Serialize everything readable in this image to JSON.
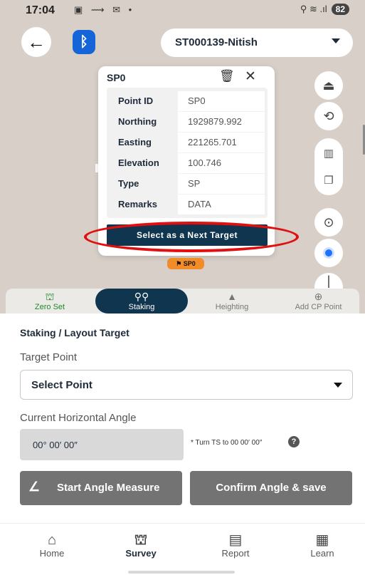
{
  "status_bar": {
    "time": "17:04",
    "left_icons": "▣ ⟿ ✉ •",
    "right_icons": "⚲ ≋ .ıl",
    "battery": "82"
  },
  "header": {
    "back_icon": "arrow-left-icon",
    "bluetooth_icon": "bluetooth-icon",
    "device_name": "ST000139-Nitish"
  },
  "popup": {
    "title": "SP0",
    "rows": [
      {
        "label": "Point ID",
        "value": "SP0"
      },
      {
        "label": "Northing",
        "value": "1929879.992"
      },
      {
        "label": "Easting",
        "value": "221265.701"
      },
      {
        "label": "Elevation",
        "value": "100.746"
      },
      {
        "label": "Type",
        "value": "SP"
      },
      {
        "label": "Remarks",
        "value": "DATA"
      }
    ],
    "next_target_label": "Select as a Next Target",
    "highlight_color": "#e01010"
  },
  "map": {
    "marker_label": "SP0",
    "marker_color": "#f28c28"
  },
  "modes": [
    {
      "label": "Zero Set",
      "icon": "tripod-icon",
      "state": "green"
    },
    {
      "label": "Staking",
      "icon": "staking-icon",
      "state": "active"
    },
    {
      "label": "Heighting",
      "icon": "heighting-icon",
      "state": "normal"
    },
    {
      "label": "Add CP Point",
      "icon": "add-point-icon",
      "state": "normal"
    }
  ],
  "staking": {
    "section_title": "Staking / Layout Target",
    "target_label": "Target Point",
    "target_value": "Select Point",
    "angle_label": "Current Horizontal Angle",
    "angle_value": "00° 00′ 00″",
    "angle_hint": "* Turn TS to 00 00′ 00″",
    "start_button": "Start Angle Measure",
    "confirm_button": "Confirm Angle & save"
  },
  "bottom_nav": [
    {
      "label": "Home",
      "icon": "home-icon"
    },
    {
      "label": "Survey",
      "icon": "survey-icon",
      "active": true
    },
    {
      "label": "Report",
      "icon": "report-icon"
    },
    {
      "label": "Learn",
      "icon": "learn-icon"
    }
  ],
  "colors": {
    "primary_dark": "#10354f",
    "accent_blue": "#1565d8",
    "map_bg": "#d8d0c8"
  }
}
